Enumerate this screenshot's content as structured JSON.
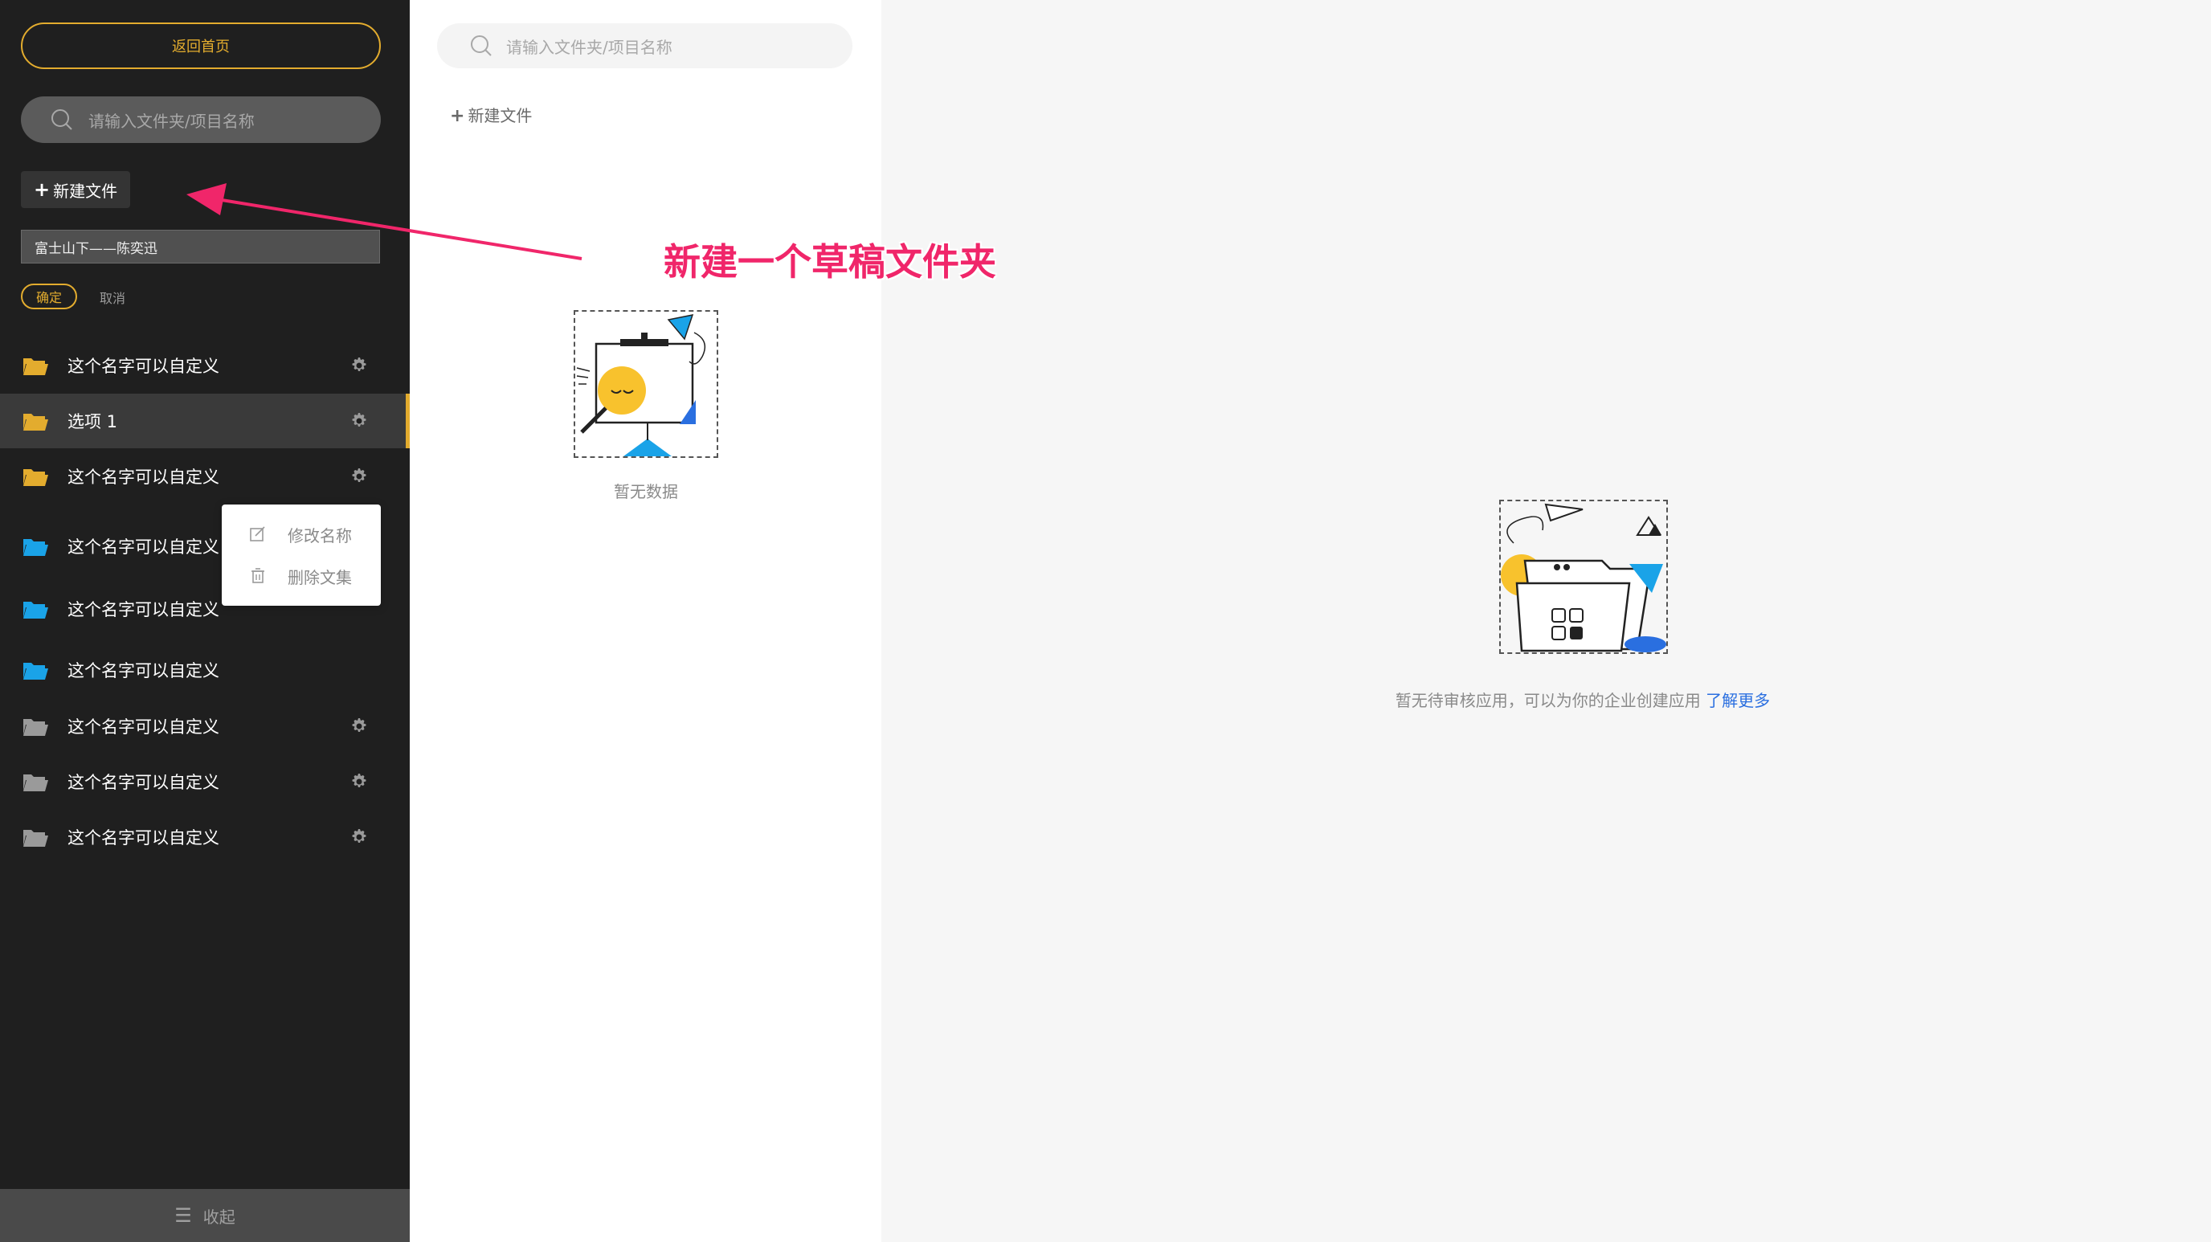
{
  "sidebar": {
    "home_label": "返回首页",
    "search_placeholder": "请输入文件夹/项目名称",
    "new_file_label": "新建文件",
    "rename_value": "富士山下——陈奕迅",
    "confirm_label": "确定",
    "cancel_label": "取消",
    "folders": [
      {
        "label": "这个名字可以自定义",
        "color": "#e3ac2e",
        "gear": true,
        "active": false
      },
      {
        "label": "选项 1",
        "color": "#e3ac2e",
        "gear": true,
        "active": true
      },
      {
        "label": "这个名字可以自定义",
        "color": "#e3ac2e",
        "gear": true,
        "active": false
      },
      {
        "label": "这个名字可以自定义",
        "color": "#1aa3e8",
        "gear": false,
        "active": false
      },
      {
        "label": "这个名字可以自定义",
        "color": "#1aa3e8",
        "gear": false,
        "active": false
      },
      {
        "label": "这个名字可以自定义",
        "color": "#1aa3e8",
        "gear": false,
        "active": false
      },
      {
        "label": "这个名字可以自定义",
        "color": "#9a9a9a",
        "gear": true,
        "active": false
      },
      {
        "label": "这个名字可以自定义",
        "color": "#9a9a9a",
        "gear": true,
        "active": false
      },
      {
        "label": "这个名字可以自定义",
        "color": "#9a9a9a",
        "gear": true,
        "active": false
      }
    ],
    "collapse_label": "收起"
  },
  "context_menu": {
    "rename_label": "修改名称",
    "delete_label": "删除文集"
  },
  "middle": {
    "search_placeholder": "请输入文件夹/项目名称",
    "new_file_label": "新建文件",
    "empty_text": "暂无数据"
  },
  "right": {
    "empty_text": "暂无待审核应用，可以为你的企业创建应用",
    "learn_more": "了解更多"
  },
  "annotation": {
    "text": "新建一个草稿文件夹",
    "color": "#f0266a"
  },
  "colors": {
    "accent": "#e3ac2e",
    "sidebar_bg": "#1f1f1f",
    "link": "#2a6fe0"
  }
}
